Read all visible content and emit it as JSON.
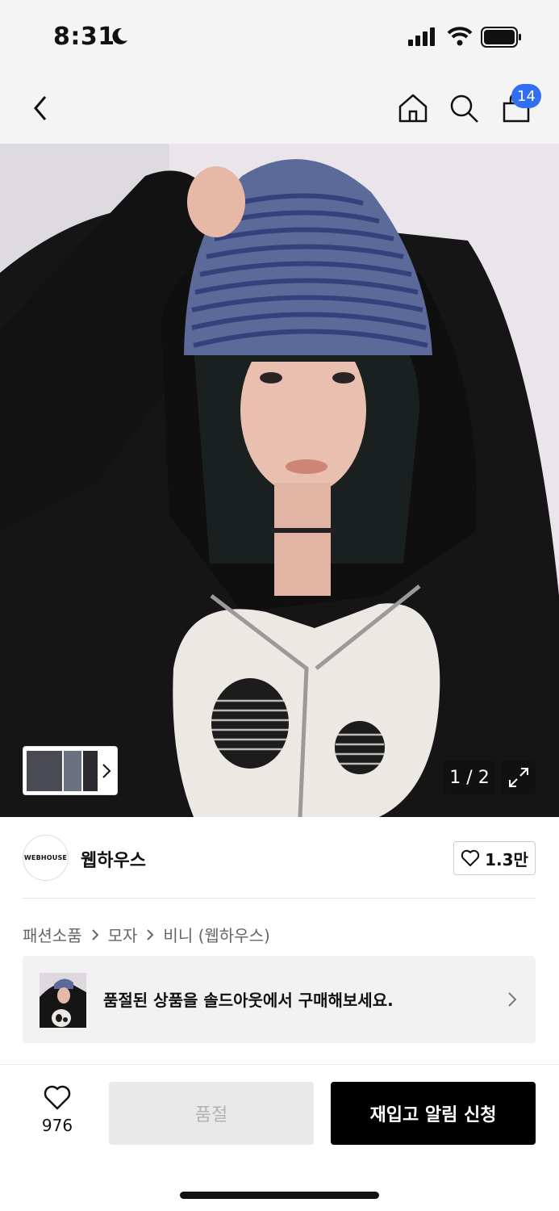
{
  "status_bar": {
    "time": "8:31"
  },
  "nav": {
    "cart_count": "14"
  },
  "gallery": {
    "page_indicator": "1 / 2"
  },
  "brand": {
    "logo_text": "WEBHOUSE",
    "name": "웹하우스",
    "like_count": "1.3만"
  },
  "breadcrumb": [
    "패션소품",
    "모자",
    "비니 (웹하우스)"
  ],
  "soldout_banner": {
    "text": "품절된 상품을 솔드아웃에서 구매해보세요."
  },
  "bottom_bar": {
    "wish_count": "976",
    "soldout_label": "품절",
    "restock_label": "재입고 알림 신청"
  },
  "colors": {
    "badge": "#2f6ff0",
    "primary_button": "#000000"
  }
}
